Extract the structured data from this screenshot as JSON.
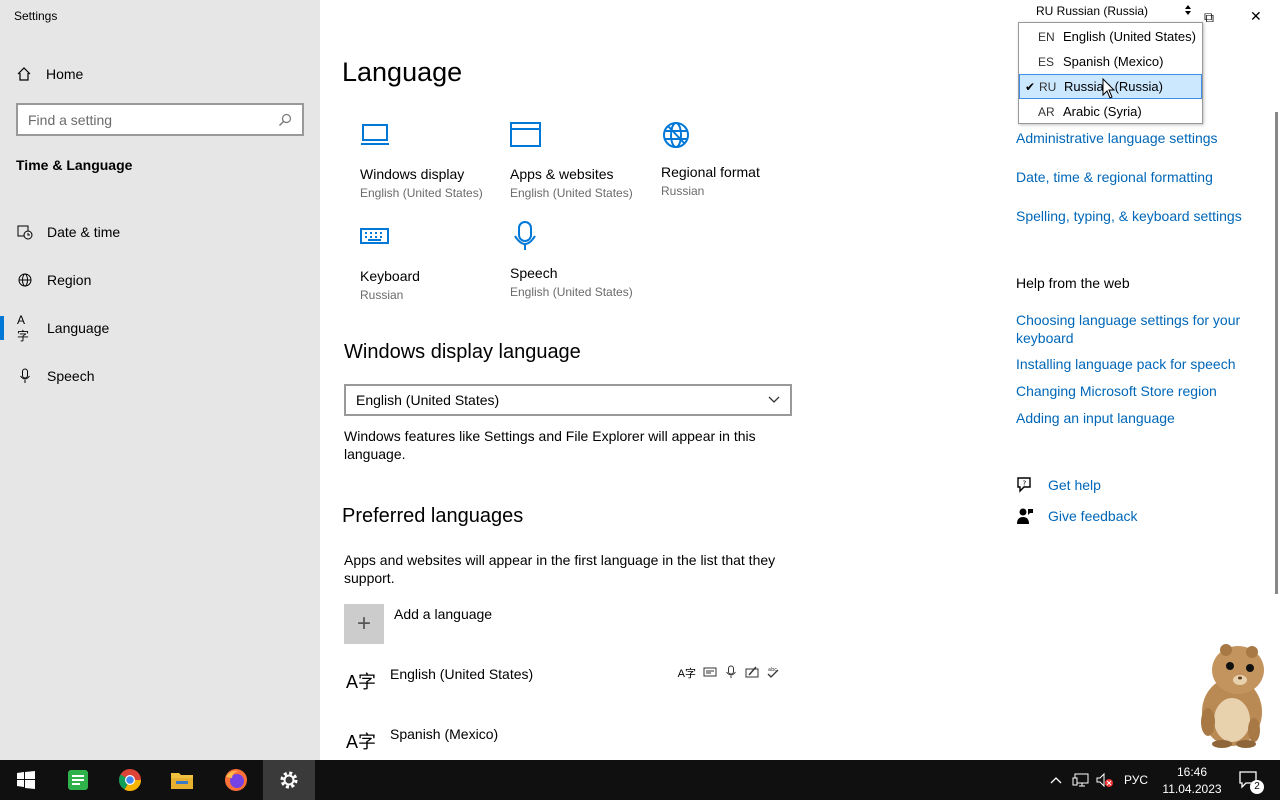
{
  "window": {
    "title": "Settings",
    "minimize_glyph": "—",
    "restore_glyph": "⧉",
    "close_glyph": "✕"
  },
  "sidebar": {
    "home_label": "Home",
    "search_placeholder": "Find a setting",
    "section_title": "Time & Language",
    "items": [
      {
        "label": "Date & time",
        "icon": "clock-calendar-icon"
      },
      {
        "label": "Region",
        "icon": "globe-icon"
      },
      {
        "label": "Language",
        "icon": "language-icon",
        "active": true
      },
      {
        "label": "Speech",
        "icon": "microphone-icon"
      }
    ]
  },
  "main": {
    "title": "Language",
    "tiles": [
      {
        "label": "Windows display",
        "sub": "English (United States)",
        "icon": "monitor-icon"
      },
      {
        "label": "Apps & websites",
        "sub": "English (United States)",
        "icon": "browser-window-icon"
      },
      {
        "label": "Regional format",
        "sub": "Russian",
        "icon": "globe-icon"
      },
      {
        "label": "Keyboard",
        "sub": "Russian",
        "icon": "keyboard-icon"
      },
      {
        "label": "Speech",
        "sub": "English (United States)",
        "icon": "microphone-icon"
      }
    ],
    "display_lang_heading": "Windows display language",
    "display_lang_value": "English (United States)",
    "display_lang_desc": "Windows features like Settings and File Explorer will appear in this language.",
    "preferred_heading": "Preferred languages",
    "preferred_desc": "Apps and websites will appear in the first language in the list that they support.",
    "add_language_label": "Add a language",
    "languages": [
      {
        "name": "English (United States)",
        "glyph": "A字"
      },
      {
        "name": "Spanish (Mexico)",
        "glyph": "A字"
      }
    ]
  },
  "right": {
    "links_top": [
      "Administrative language settings",
      "Date, time & regional formatting",
      "Spelling, typing, & keyboard settings"
    ],
    "help_heading": "Help from the web",
    "help_links": [
      "Choosing language settings for your keyboard",
      "Installing language pack for speech",
      "Changing Microsoft Store region",
      "Adding an input language"
    ],
    "get_help": "Get help",
    "give_feedback": "Give feedback"
  },
  "input_indicator": {
    "current_label": "RU Russian (Russia)",
    "options": [
      {
        "code": "EN",
        "name": "English (United States)",
        "selected": false
      },
      {
        "code": "ES",
        "name": "Spanish (Mexico)",
        "selected": false
      },
      {
        "code": "RU",
        "name": "Russian (Russia)",
        "selected": true
      },
      {
        "code": "AR",
        "name": "Arabic (Syria)",
        "selected": false
      }
    ]
  },
  "taskbar": {
    "apps": [
      "start-icon",
      "spreadsheet-app-icon",
      "chrome-icon",
      "file-explorer-icon",
      "firefox-icon",
      "settings-icon"
    ],
    "lang": "РУС",
    "time": "16:46",
    "date": "11.04.2023",
    "notifications_count": "2"
  },
  "colors": {
    "accent": "#0078d7",
    "link": "#0067b8",
    "sidebar_bg": "#e6e6e6",
    "taskbar_bg": "#101010"
  }
}
